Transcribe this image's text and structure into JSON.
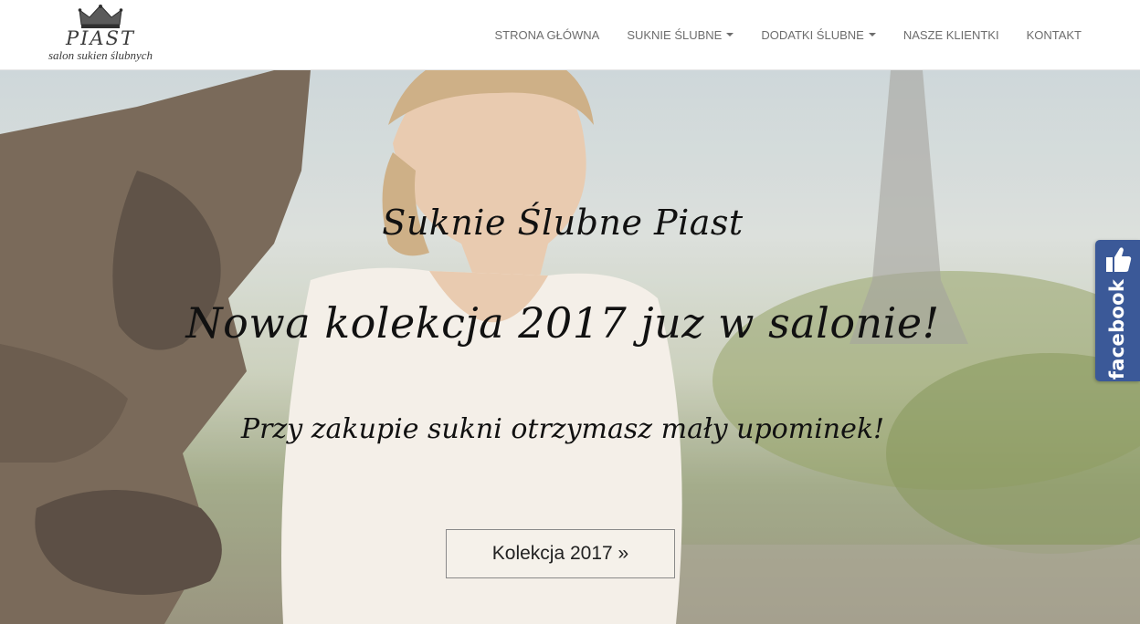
{
  "brand": {
    "name": "PIAST",
    "tagline": "salon sukien ślubnych",
    "logo_icon": "crown-icon"
  },
  "nav": {
    "items": [
      {
        "label": "STRONA GŁÓWNA",
        "dropdown": false
      },
      {
        "label": "SUKNIE ŚLUBNE",
        "dropdown": true
      },
      {
        "label": "DODATKI ŚLUBNE",
        "dropdown": true
      },
      {
        "label": "NASZE KLIENTKI",
        "dropdown": false
      },
      {
        "label": "KONTAKT",
        "dropdown": false
      }
    ]
  },
  "hero": {
    "title": "Suknie Ślubne Piast",
    "heading": "Nowa kolekcja 2017 juz w salonie!",
    "subtitle": "Przy zakupie sukni otrzymasz mały upominek!",
    "cta_label": "Kolekcja 2017 »"
  },
  "facebook_tab": {
    "label": "facebook",
    "icon": "thumbs-up-icon",
    "color": "#3b5998"
  },
  "colors": {
    "nav_text": "#6d6d6d",
    "heading_text": "#111111"
  }
}
